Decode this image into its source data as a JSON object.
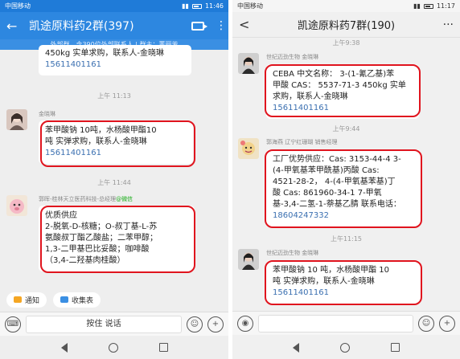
{
  "left": {
    "status": {
      "carrier": "中国移动",
      "time": "11:46"
    },
    "header": {
      "back": "←",
      "title": "凯途原料药2群(397)",
      "more": "⋮",
      "external": "外部群，含390位外部联系人 | 群主：董丽芳"
    },
    "msg0": {
      "line1": "450kg 实单求购，联系人-金晓琳",
      "phone": "15611401161"
    },
    "time1": "上午 11:13",
    "msg1": {
      "nick": "金晓琳",
      "line1": "苯甲酸钠 10吨，水杨酸甲酯10",
      "line2": "吨 实弹求购，联系人-金晓琳",
      "phone": "15611401161"
    },
    "time2": "上午 11:44",
    "msg2": {
      "nick": "郭晖-桂林天立医药科技-总经理",
      "nick_suffix": "@微信",
      "lines": [
        "优质供应",
        "2-脱氧-D-核糖；O-叔丁基-L-苏",
        "氨酸叔丁酯乙酸盐；二苯甲醇；",
        "1,3-二甲基巴比妥酸；咖啡酸",
        "（3,4-二羟基肉桂酸）"
      ]
    },
    "quick": [
      {
        "label": "通知",
        "icon": "megaphone-icon"
      },
      {
        "label": "收集表",
        "icon": "form-icon"
      }
    ],
    "input": {
      "talk": "按住 说话"
    }
  },
  "right": {
    "status": {
      "carrier": "中国移动",
      "time": "11:17"
    },
    "header": {
      "back": "<",
      "title": "凯途原料药7群(190)",
      "more": "···"
    },
    "time0": "上午9:38",
    "msg1": {
      "nick": "世纪迈劲生物 金晓琳",
      "lines": [
        "CEBA 中文名称： 3-(1-氰乙基)苯",
        "甲酸 CAS： 5537-71-3 450kg 实单",
        "求购，联系人-金晓琳"
      ],
      "phone": "15611401161"
    },
    "time1": "上午9:44",
    "msg2": {
      "nick": "郭海燕 辽宁红珊瑚 销售经理",
      "lines": [
        "工厂优势供应：Cas: 3153-44-4 3-",
        "(4-甲氧基苯甲酰基)丙酸 Cas:",
        "4521-28-2， 4-(4-甲氧基苯基)丁",
        "酸  Cas: 861960-34-1 7-甲氧",
        "基-3,4-二氢-1-萘基乙腈 联系电话："
      ],
      "phone": "18604247332"
    },
    "time2": "上午11:15",
    "msg3": {
      "nick": "世纪迈劲生物 金晓琳",
      "line1": "苯甲酸钠 10 吨，水杨酸甲酯 10",
      "line2": "吨 实弹求购，联系人-金晓琳",
      "phone": "15611401161"
    },
    "input": {
      "talk": ""
    }
  },
  "colors": {
    "highlight": "#e0141e",
    "header_blue": "#2d87e0",
    "link": "#3a6fb0"
  }
}
